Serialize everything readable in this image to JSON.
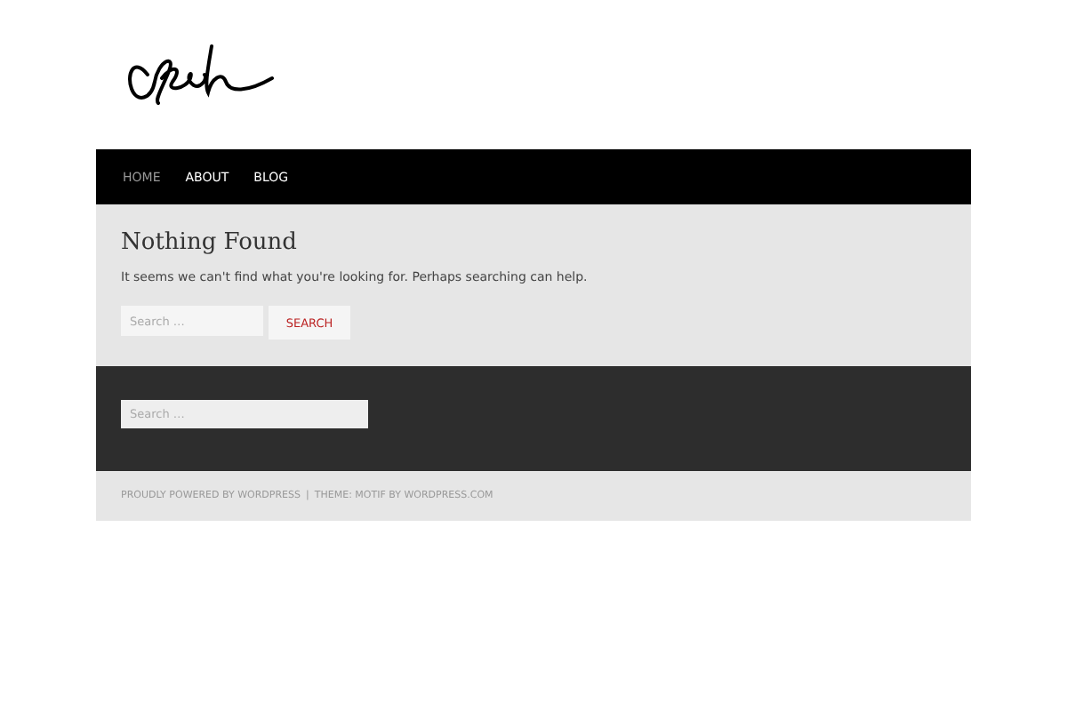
{
  "nav": [
    {
      "label": "HOME",
      "selected": true
    },
    {
      "label": "ABOUT",
      "selected": false
    },
    {
      "label": "BLOG",
      "selected": false
    }
  ],
  "main": {
    "title": "Nothing Found",
    "message": "It seems we can't find what you're looking for. Perhaps searching can help.",
    "search": {
      "placeholder": "Search …",
      "button": "SEARCH"
    }
  },
  "widgets": {
    "search": {
      "placeholder": "Search …"
    }
  },
  "site_info": {
    "powered": "PROUDLY POWERED BY WORDPRESS",
    "separator": "|",
    "theme": "THEME: MOTIF BY WORDPRESS.COM"
  }
}
